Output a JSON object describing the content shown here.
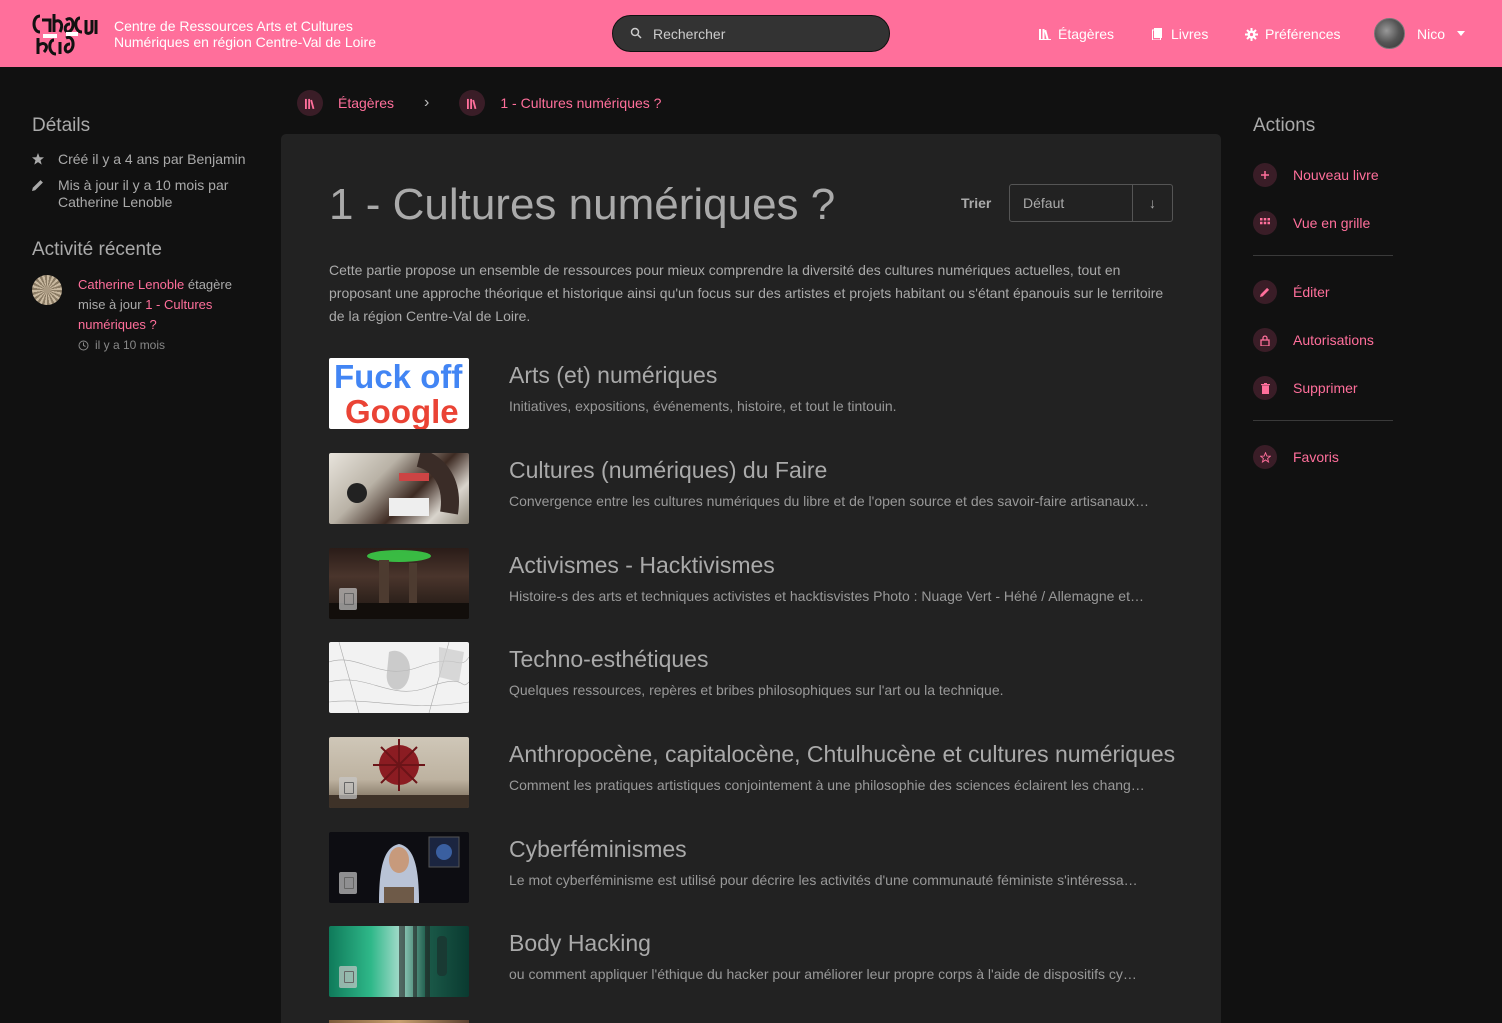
{
  "header": {
    "site_name_line1": "Centre de Ressources Arts et Cultures",
    "site_name_line2": "Numériques en région Centre-Val de Loire",
    "search_placeholder": "Rechercher",
    "nav": {
      "shelves": "Étagères",
      "books": "Livres",
      "preferences": "Préférences"
    },
    "user_name": "Nico"
  },
  "details": {
    "heading": "Détails",
    "created": "Créé il y a 4 ans par Benjamin",
    "updated": "Mis à jour il y a 10 mois par Catherine Lenoble"
  },
  "activity": {
    "heading": "Activité récente",
    "user": "Catherine Lenoble",
    "action": " étagère mise à jour ",
    "target": "1 - Cultures numériques ?",
    "time": "il y a 10 mois"
  },
  "breadcrumb": {
    "item1": "Étagères",
    "item2": "1 - Cultures numériques ?"
  },
  "shelf": {
    "title": "1 - Cultures numériques ?",
    "sort_label": "Trier",
    "sort_value": "Défaut",
    "sort_dir": "↓",
    "description": "Cette partie propose un ensemble de ressources pour mieux comprendre la diversité des cultures numériques actuelles, tout en proposant une approche théorique et historique ainsi qu'un focus sur des artistes et projets habitant ou s'étant épanouis sur le territoire de la région Centre-Val de Loire.",
    "thumb_text_line1": "Fuck off",
    "thumb_text_line2": "Google",
    "books": [
      {
        "title": "Arts (et) numériques",
        "desc": "Initiatives, expositions, événements, histoire, et tout le tintouin."
      },
      {
        "title": "Cultures (numériques) du Faire",
        "desc": "Convergence entre les cultures numériques du libre et de l'open source et des savoir-faire artisanaux…"
      },
      {
        "title": "Activismes - Hacktivismes",
        "desc": "Histoire-s des arts et techniques activistes et hacktisvistes Photo : Nuage Vert - Héhé / Allemagne et…"
      },
      {
        "title": "Techno-esthétiques",
        "desc": "Quelques ressources, repères et bribes philosophiques sur l'art ou la technique."
      },
      {
        "title": "Anthropocène, capitalocène, Chtulhucène et cultures numériques",
        "desc": "Comment les pratiques artistiques conjointement à une philosophie des sciences éclairent les chang…"
      },
      {
        "title": "Cyberféminismes",
        "desc": "Le mot cyberféminisme est utilisé pour décrire les activités d'une communauté féministe s'intéressa…"
      },
      {
        "title": "Body Hacking",
        "desc": "ou comment appliquer l'éthique du hacker pour améliorer leur propre corps à l'aide de dispositifs cy…"
      }
    ]
  },
  "actions": {
    "heading": "Actions",
    "new_book": "Nouveau livre",
    "grid_view": "Vue en grille",
    "edit": "Éditer",
    "permissions": "Autorisations",
    "delete": "Supprimer",
    "favorites": "Favoris"
  },
  "colors": {
    "accent": "#ff6f9b",
    "background": "#111111",
    "card": "#222222"
  }
}
